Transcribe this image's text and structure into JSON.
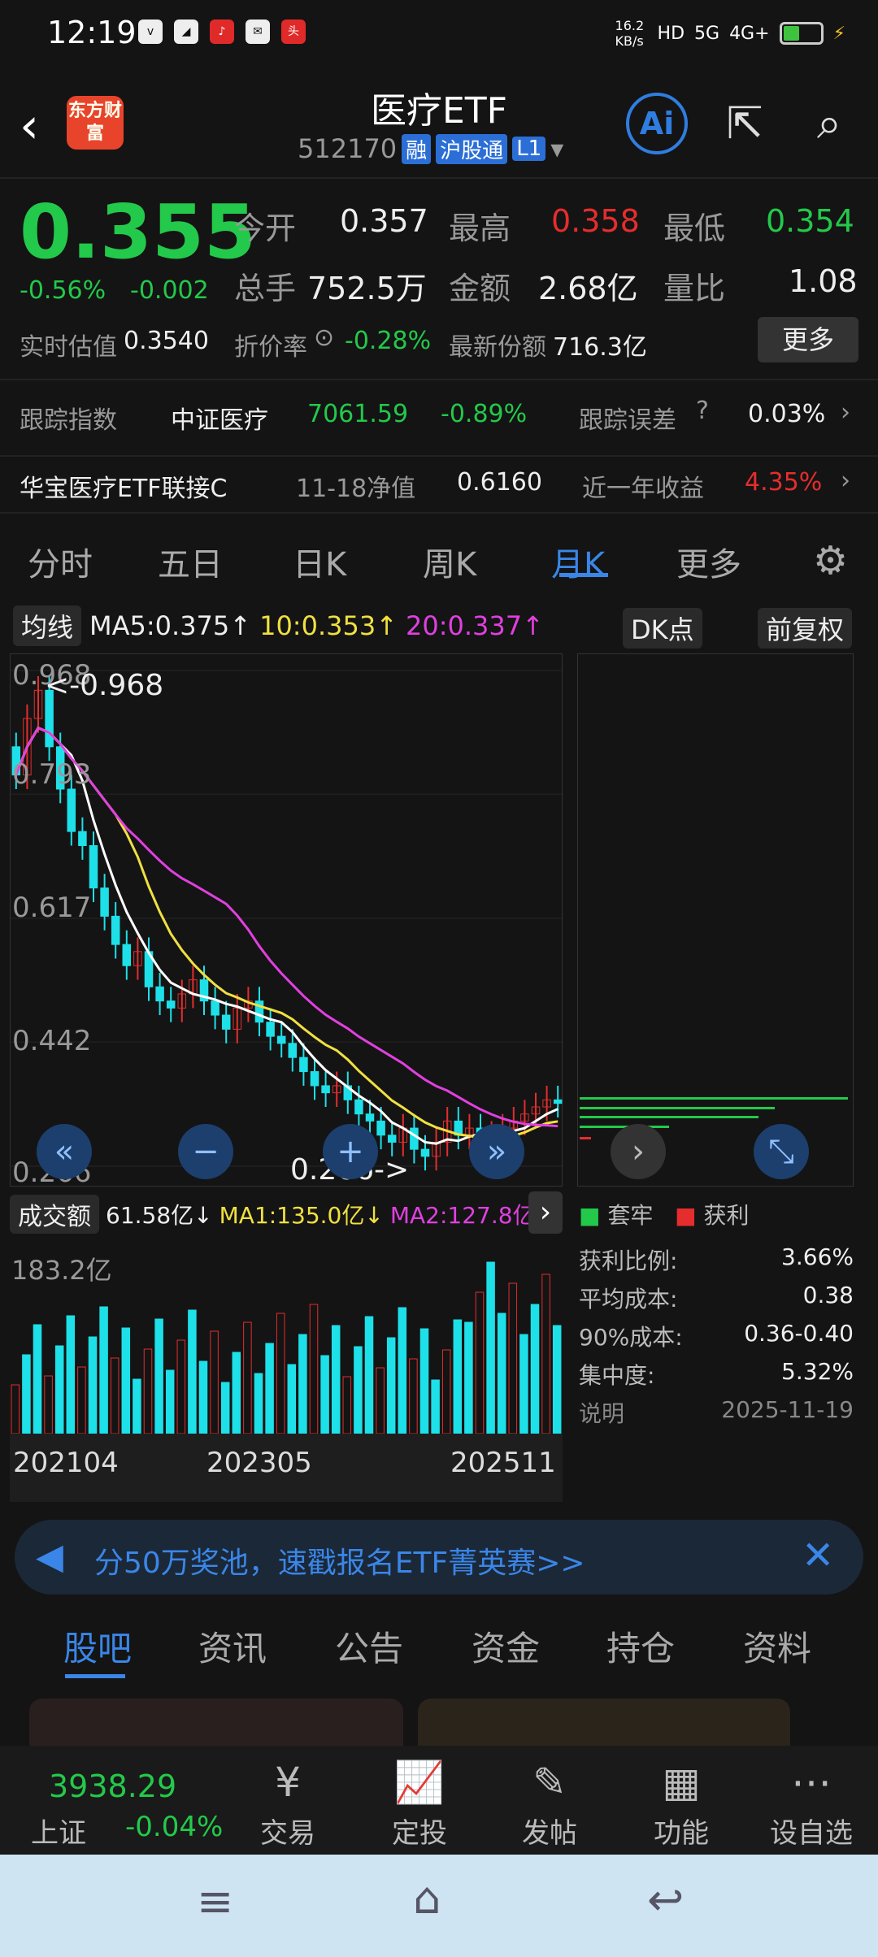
{
  "status": {
    "time": "12:19",
    "speed": "16.2 KB/s",
    "net1": "5G",
    "net2": "4G+"
  },
  "header": {
    "title": "医疗ETF",
    "code": "512170",
    "tags": [
      "融",
      "沪股通",
      "L1"
    ],
    "logo": "东方财富"
  },
  "quote": {
    "price": "0.355",
    "pct": "-0.56%",
    "chg": "-0.002",
    "open_label": "今开",
    "open": "0.357",
    "high_label": "最高",
    "high": "0.358",
    "low_label": "最低",
    "low": "0.354",
    "vol_label": "总手",
    "vol": "752.5万",
    "amt_label": "金额",
    "amt": "2.68亿",
    "ratio_label": "量比",
    "ratio": "1.08",
    "iopv_label": "实时估值",
    "iopv": "0.3540",
    "disc_label": "折价率",
    "disc": "-0.28%",
    "share_label": "最新份额",
    "share": "716.3亿",
    "more": "更多"
  },
  "track": {
    "label": "跟踪指数",
    "index": "中证医疗",
    "value": "7061.59",
    "pct": "-0.89%",
    "err_label": "跟踪误差",
    "err": "0.03%"
  },
  "link": {
    "name": "华宝医疗ETF联接C",
    "nav_label": "11-18净值",
    "nav": "0.6160",
    "ret_label": "近一年收益",
    "ret": "4.35%"
  },
  "tabs": [
    "分时",
    "五日",
    "日K",
    "周K",
    "月K",
    "更多"
  ],
  "ma": {
    "label": "均线",
    "ma5": "MA5:0.375↑",
    "ma10": "10:0.353↑",
    "ma20": "20:0.337↑",
    "dk": "DK点",
    "fq": "前复权"
  },
  "chart_data": {
    "type": "candlestick",
    "yticks": [
      "0.968",
      "0.793",
      "0.617",
      "0.442",
      "0.266"
    ],
    "max_label": "<-0.968",
    "min_label": "0.266->",
    "closes": [
      0.82,
      0.9,
      0.94,
      0.86,
      0.8,
      0.74,
      0.72,
      0.66,
      0.62,
      0.58,
      0.55,
      0.57,
      0.52,
      0.5,
      0.49,
      0.51,
      0.53,
      0.5,
      0.48,
      0.46,
      0.49,
      0.5,
      0.47,
      0.45,
      0.44,
      0.42,
      0.4,
      0.38,
      0.37,
      0.38,
      0.36,
      0.34,
      0.33,
      0.31,
      0.3,
      0.32,
      0.29,
      0.28,
      0.3,
      0.33,
      0.31,
      0.32,
      0.3,
      0.31,
      0.32,
      0.33,
      0.34,
      0.35,
      0.36,
      0.355
    ]
  },
  "vol": {
    "label": "成交额",
    "v": "61.58亿↓",
    "ma1": "MA1:135.0亿↓",
    "ma2": "MA2:127.8亿↓",
    "max": "183.2亿",
    "x1": "202104",
    "x2": "202305",
    "x3": "202511"
  },
  "chip": {
    "legend1": "套牢",
    "legend2": "获利",
    "rows": [
      [
        "获利比例:",
        "3.66%"
      ],
      [
        "平均成本:",
        "0.38"
      ],
      [
        "90%成本:",
        "0.36-0.40"
      ],
      [
        "集中度:",
        "5.32%"
      ]
    ],
    "note": "说明",
    "date": "2025-11-19"
  },
  "banner": {
    "text": "分50万奖池，速戳报名ETF菁英赛>>"
  },
  "btabs": [
    "股吧",
    "资讯",
    "公告",
    "资金",
    "持仓",
    "资料"
  ],
  "nav": {
    "index_val": "3938.29",
    "index_name": "上证",
    "index_pct": "-0.04%",
    "items": [
      "交易",
      "定投",
      "发帖",
      "功能",
      "设自选"
    ]
  }
}
